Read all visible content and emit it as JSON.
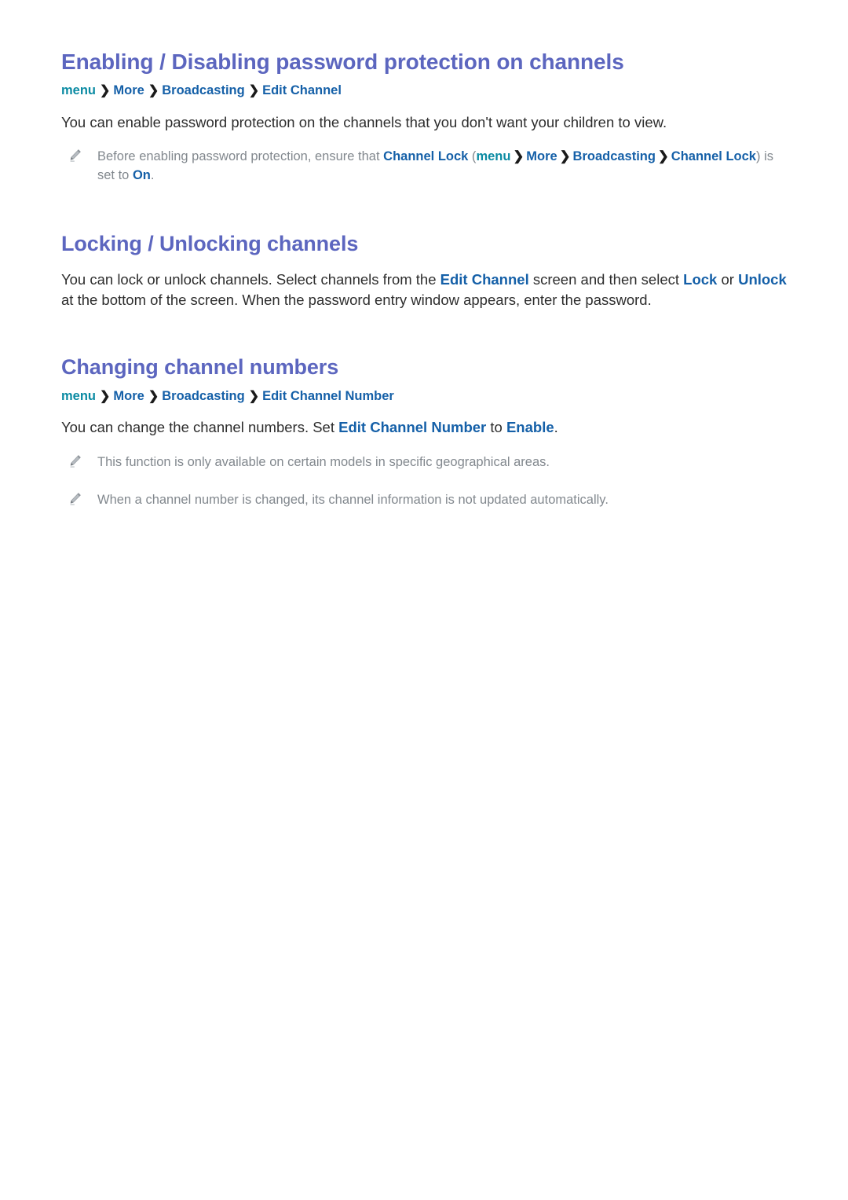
{
  "document": {
    "background_color": "#ffffff",
    "heading_color": "#5c66bf",
    "link_color": "#1560a8",
    "menu_color": "#0b8ba3",
    "body_color": "#2d2d2d",
    "note_color": "#82888e"
  },
  "sections": [
    {
      "heading": "Enabling / Disabling password protection on channels",
      "breadcrumb": {
        "items": [
          "menu",
          "More",
          "Broadcasting",
          "Edit Channel"
        ],
        "separator": "❯"
      },
      "paragraph": {
        "prefix": "You can enable password protection on the channels that you don't want your children to view."
      },
      "notes": [
        {
          "icon": "pencil-icon",
          "parts": [
            {
              "text": "Before enabling password protection, ensure that ",
              "style": "plain"
            },
            {
              "text": "Channel Lock",
              "style": "blue"
            },
            {
              "text": " (",
              "style": "plain"
            },
            {
              "text": "menu",
              "style": "teal"
            },
            {
              "text": "❯",
              "style": "chevron"
            },
            {
              "text": "More",
              "style": "blue"
            },
            {
              "text": "❯",
              "style": "chevron"
            },
            {
              "text": "Broadcasting",
              "style": "blue"
            },
            {
              "text": "❯",
              "style": "chevron"
            },
            {
              "text": "Channel Lock",
              "style": "blue"
            },
            {
              "text": ") is set to ",
              "style": "plain"
            },
            {
              "text": "On",
              "style": "blue"
            },
            {
              "text": ".",
              "style": "plain"
            }
          ]
        }
      ]
    },
    {
      "heading": "Locking / Unlocking channels",
      "breadcrumb": null,
      "paragraph": {
        "parts": [
          {
            "text": "You can lock or unlock channels. Select channels from the ",
            "style": "plain"
          },
          {
            "text": "Edit Channel",
            "style": "link"
          },
          {
            "text": " screen and then select ",
            "style": "plain"
          },
          {
            "text": "Lock",
            "style": "link"
          },
          {
            "text": " or ",
            "style": "plain"
          },
          {
            "text": "Unlock",
            "style": "link"
          },
          {
            "text": " at the bottom of the screen. When the password entry window appears, enter the password.",
            "style": "plain"
          }
        ]
      },
      "notes": []
    },
    {
      "heading": "Changing channel numbers",
      "breadcrumb": {
        "items": [
          "menu",
          "More",
          "Broadcasting",
          "Edit Channel Number"
        ],
        "separator": "❯"
      },
      "paragraph": {
        "parts": [
          {
            "text": "You can change the channel numbers. Set ",
            "style": "plain"
          },
          {
            "text": "Edit Channel Number",
            "style": "link"
          },
          {
            "text": " to ",
            "style": "plain"
          },
          {
            "text": "Enable",
            "style": "link"
          },
          {
            "text": ".",
            "style": "plain"
          }
        ]
      },
      "notes": [
        {
          "icon": "pencil-icon",
          "parts": [
            {
              "text": "This function is only available on certain models in specific geographical areas.",
              "style": "plain"
            }
          ]
        },
        {
          "icon": "pencil-icon",
          "parts": [
            {
              "text": "When a channel number is changed, its channel information is not updated automatically.",
              "style": "plain"
            }
          ]
        }
      ]
    }
  ]
}
